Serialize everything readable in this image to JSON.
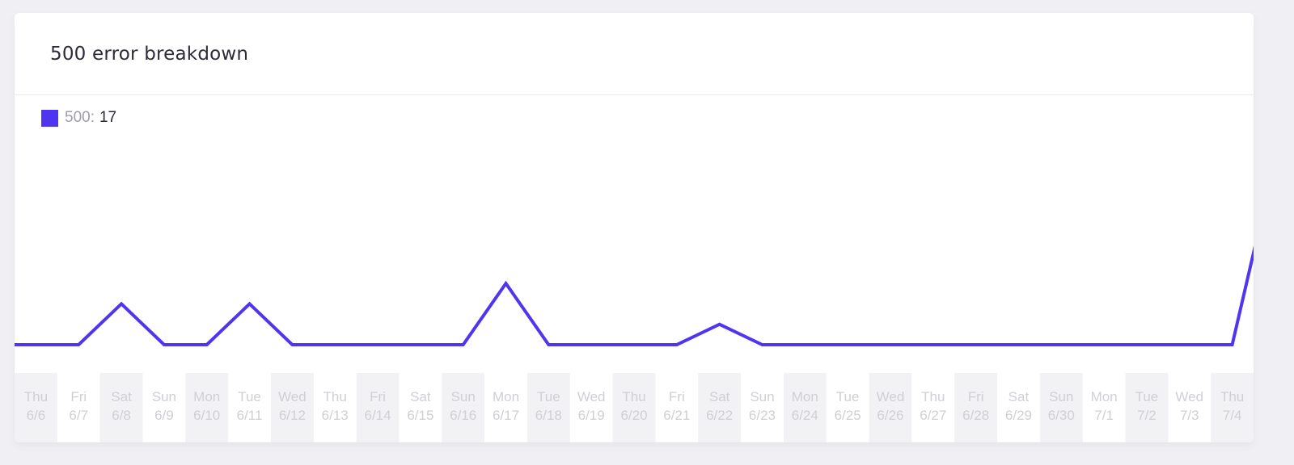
{
  "header": {
    "title": "500 error breakdown"
  },
  "legend": {
    "label": "500:",
    "value": "17",
    "color": "#4f35f0"
  },
  "colors": {
    "line": "#4f35f0",
    "stripe": "#f2f2f5",
    "label": "#cfcfd5"
  },
  "chart_data": {
    "type": "line",
    "title": "500 error breakdown",
    "xlabel": "",
    "ylabel": "",
    "grid": false,
    "legend_position": "top-left",
    "categories": [
      {
        "day": "Thu",
        "date": "6/6"
      },
      {
        "day": "Fri",
        "date": "6/7"
      },
      {
        "day": "Sat",
        "date": "6/8"
      },
      {
        "day": "Sun",
        "date": "6/9"
      },
      {
        "day": "Mon",
        "date": "6/10"
      },
      {
        "day": "Tue",
        "date": "6/11"
      },
      {
        "day": "Wed",
        "date": "6/12"
      },
      {
        "day": "Thu",
        "date": "6/13"
      },
      {
        "day": "Fri",
        "date": "6/14"
      },
      {
        "day": "Sat",
        "date": "6/15"
      },
      {
        "day": "Sun",
        "date": "6/16"
      },
      {
        "day": "Mon",
        "date": "6/17"
      },
      {
        "day": "Tue",
        "date": "6/18"
      },
      {
        "day": "Wed",
        "date": "6/19"
      },
      {
        "day": "Thu",
        "date": "6/20"
      },
      {
        "day": "Fri",
        "date": "6/21"
      },
      {
        "day": "Sat",
        "date": "6/22"
      },
      {
        "day": "Sun",
        "date": "6/23"
      },
      {
        "day": "Mon",
        "date": "6/24"
      },
      {
        "day": "Tue",
        "date": "6/25"
      },
      {
        "day": "Wed",
        "date": "6/26"
      },
      {
        "day": "Thu",
        "date": "6/27"
      },
      {
        "day": "Fri",
        "date": "6/28"
      },
      {
        "day": "Sat",
        "date": "6/29"
      },
      {
        "day": "Sun",
        "date": "6/30"
      },
      {
        "day": "Mon",
        "date": "7/1"
      },
      {
        "day": "Tue",
        "date": "7/2"
      },
      {
        "day": "Wed",
        "date": "7/3"
      },
      {
        "day": "Thu",
        "date": "7/4"
      }
    ],
    "series": [
      {
        "name": "500",
        "total": 17,
        "values_before": [
          0
        ],
        "values": [
          0,
          0,
          2,
          0,
          0,
          2,
          0,
          0,
          0,
          0,
          0,
          3,
          0,
          0,
          0,
          0,
          1,
          0,
          0,
          0,
          0,
          0,
          0,
          0,
          0,
          0,
          0,
          0,
          0
        ],
        "values_after": [
          9
        ]
      }
    ],
    "ylim": [
      0,
      11
    ]
  }
}
